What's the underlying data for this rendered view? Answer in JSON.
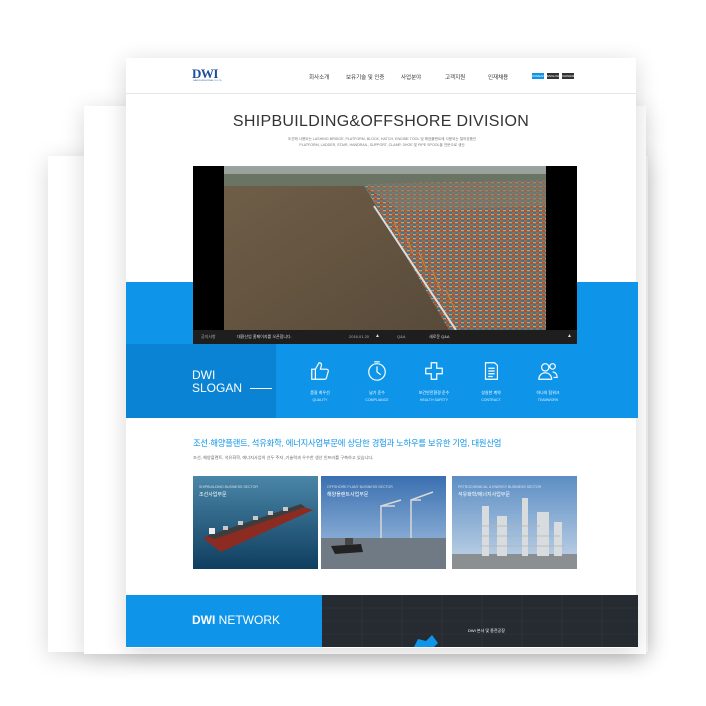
{
  "colors": {
    "accent": "#0e95e9",
    "accent_dark": "#0a7fd0",
    "dark": "#262a31",
    "logo": "#1b4f9c"
  },
  "header": {
    "logo": "DWI",
    "logo_sub": "DAWON INDUSTRIAL CO.,LTD.",
    "nav": [
      "회사소개",
      "보유기술 및 인증",
      "사업분야",
      "고객지원",
      "인재채용"
    ],
    "languages": [
      "KOREAN",
      "ENGLISH",
      "CHINESE"
    ]
  },
  "hero": {
    "title": "SHIPBUILDING&OFFSHORE DIVISION",
    "caption_1": "조선해 사용되는 LASHING BRIDGE, PLATFORM, BLOCK, HATCH, ENGINE TOOL 및 해양플랜트에 사용되는 철의장품인",
    "caption_2": "PLATFORM, LADDER, STAIR, HANDRAIL, SUPPORT, CLAMP, SHOE 및 PIPE SPOOL을 전문으로 생산"
  },
  "notice_bar": {
    "notice_label": "공지사항",
    "notice_text": "대환산업 홈페이지를 오픈합니다.",
    "notice_date": "2016.01.20",
    "qa_label": "Q&A",
    "qa_text": "새로운 Q&A"
  },
  "slogan": {
    "title_1": "DWI",
    "title_2": "SLOGAN",
    "items": [
      {
        "icon": "thumbs-up-icon",
        "ko": "품질 최우선",
        "en": "QUALITY"
      },
      {
        "icon": "clock-icon",
        "ko": "납기 준수",
        "en": "COMPLIANCE"
      },
      {
        "icon": "health-cross-icon",
        "ko": "보건안전환경 준수",
        "en": "HEALTH SAFETY"
      },
      {
        "icon": "document-icon",
        "ko": "성실한 계약",
        "en": "CONTRACT"
      },
      {
        "icon": "teamwork-icon",
        "ko": "하나의 팀워크",
        "en": "TEAMWORK"
      }
    ]
  },
  "business": {
    "headline": "조선·해양플랜트, 석유화학, 에너지사업부문에 상당한 경험과 노하우를 보유한 기업, 대원산업",
    "subline": "조선, 해양플랜트, 석유화학, 에너지사업의 선두 주자 ,기술력과 우수한 생산 인프라를 구축하고 있습니다.",
    "cards": [
      {
        "en": "SHIPBUILDING BUSINESS SECTOR",
        "ko": "조선사업부문"
      },
      {
        "en": "OFFSHORE PLANT BUSINESS SECTOR",
        "ko": "해양플랜트사업부문"
      },
      {
        "en": "PETROCHEMICAL & ENERGY BUSINESS SECTOR",
        "ko": "석유화학/에너지사업부문"
      }
    ]
  },
  "network": {
    "title_1": "DWI",
    "title_2": " NETWORK",
    "map_label": "DWI 본사 및 종전공장"
  }
}
